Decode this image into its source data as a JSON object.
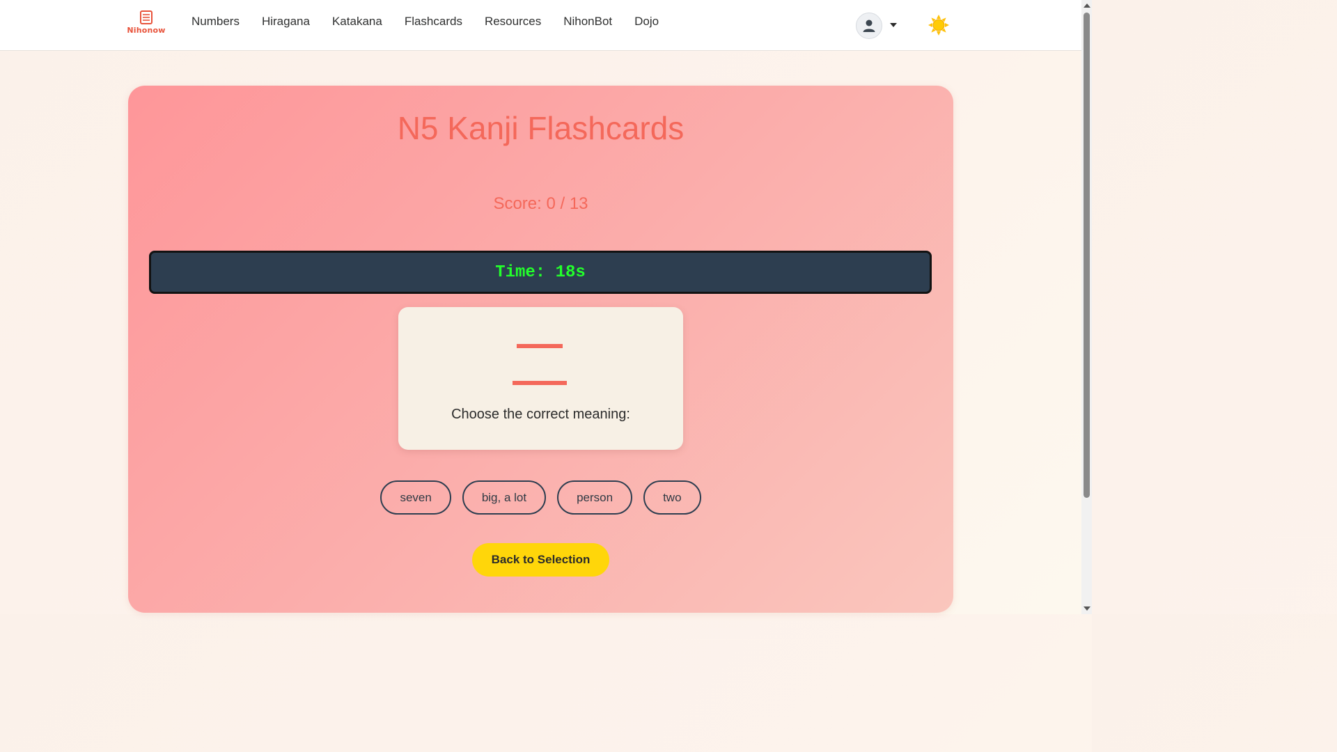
{
  "brand": {
    "name": "Nihonow",
    "icon": "book-stack-icon",
    "color": "#e8523a"
  },
  "nav": {
    "links": [
      "Numbers",
      "Hiragana",
      "Katakana",
      "Flashcards",
      "Resources",
      "NihonBot",
      "Dojo"
    ]
  },
  "header_actions": {
    "user_icon": "user-avatar-icon",
    "dropdown_icon": "caret-down-icon",
    "theme_icon": "sun-icon"
  },
  "quiz": {
    "title": "N5 Kanji Flashcards",
    "score_text": "Score: 0 / 13",
    "timer_text": "Time: 18s",
    "kanji": "二",
    "prompt": "Choose the correct meaning:",
    "options": [
      "seven",
      "big, a lot",
      "person",
      "two"
    ],
    "back_label": "Back to Selection"
  },
  "colors": {
    "accent": "#f4685a",
    "timer_bg": "#2d3e50",
    "timer_text": "#23ff2c",
    "button_yellow": "#ffd60a",
    "flashcard_bg": "#f7f0e5"
  }
}
